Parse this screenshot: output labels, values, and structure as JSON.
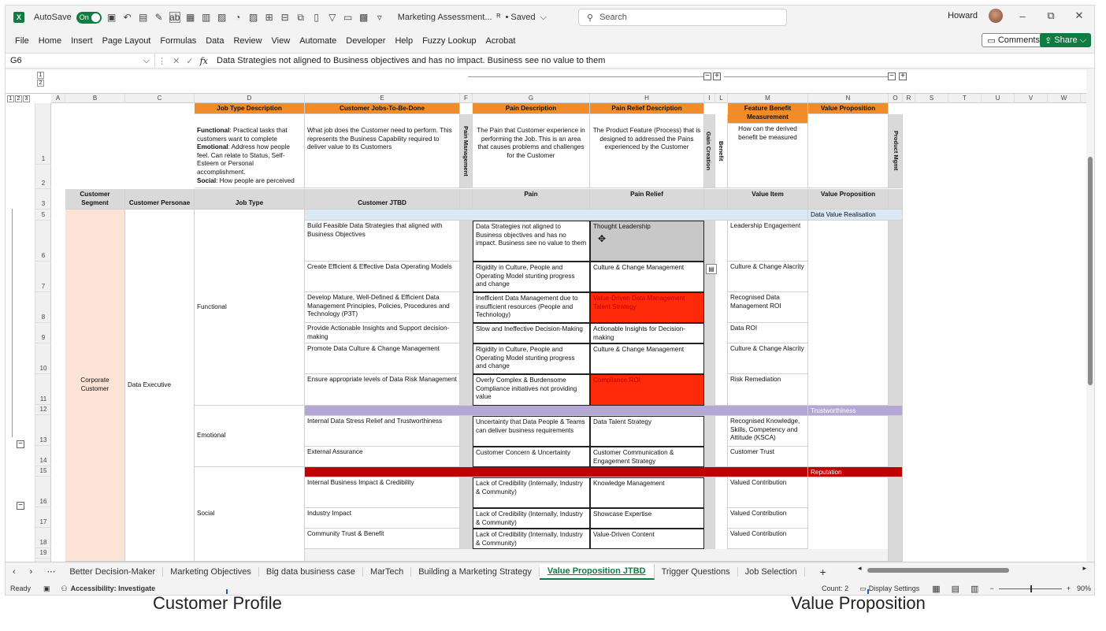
{
  "titlebar": {
    "autosave_label": "AutoSave",
    "autosave_state": "On",
    "doc_title": "Marketing Assessment...",
    "saved_status": "• Saved",
    "search_placeholder": "Search",
    "user_name": "Howard"
  },
  "menu": [
    "File",
    "Home",
    "Insert",
    "Page Layout",
    "Formulas",
    "Data",
    "Review",
    "View",
    "Automate",
    "Developer",
    "Help",
    "Fuzzy Lookup",
    "Acrobat"
  ],
  "ribbon_right": {
    "comments": "Comments",
    "share": "Share"
  },
  "formula_bar": {
    "cell_ref": "G6",
    "fx": "fx",
    "content": "Data Strategies not aligned to Business objectives and has no impact. Business see no value to them"
  },
  "outline_levels": [
    "1",
    "2",
    "3"
  ],
  "outline_rows": [
    "1",
    "2"
  ],
  "columns": [
    "A",
    "B",
    "C",
    "D",
    "E",
    "F",
    "G",
    "H",
    "I",
    "L",
    "M",
    "N",
    "O",
    "R",
    "S",
    "T",
    "U",
    "V",
    "W"
  ],
  "rows": [
    "1",
    "2",
    "3",
    "5",
    "6",
    "7",
    "8",
    "9",
    "10",
    "11",
    "12",
    "13",
    "14",
    "15",
    "16",
    "17",
    "18",
    "19"
  ],
  "header": {
    "job_type_desc": "Job Type Description",
    "jtbd": "Customer Jobs-To-Be-Done",
    "pain_desc": "Pain Description",
    "pain_relief_desc": "Pain Relief Description",
    "feature_benefit": "Feature Benefit Measurement",
    "value_prop": "Value Proposition",
    "pain_mgmt": "Pain Management",
    "gain_creation": "Gain Creation",
    "benefit": "Benefit",
    "product_mgmt": "Product Mgmt"
  },
  "descriptions": {
    "job_type_functional_label": "Functional",
    "job_type_functional": ": Practical tasks that customers want to complete",
    "job_type_emotional_label": "Emotional",
    "job_type_emotional": ": Address how people feel. Can relate to Status, Self-Esteem or Personal accomplishment.",
    "job_type_social_label": "Social",
    "job_type_social": ": How people are perceived",
    "jtbd": "What job does the Customer need to perform. This represents the Business Capability required to deliver value to its Customers",
    "pain": "The Pain that Customer experience in performing the Job. This is an area that causes problems and challenges for the Customer",
    "pain_relief": "The Product Feature (Process) that is designed to addressed the Pains experienced by the Customer",
    "benefit": "How can the derived benefit be measured"
  },
  "subheader": {
    "segment": "Customer Segment",
    "persona": "Customer Personae",
    "job_type": "Job Type",
    "jtbd": "Customer JTBD",
    "pain": "Pain",
    "pain_relief": "Pain Relief",
    "value_item": "Value Item",
    "value_prop": "Value Proposition"
  },
  "segment": "Corporate Customer",
  "persona": "Data Executive",
  "job_types": {
    "functional": "Functional",
    "emotional": "Emotional",
    "social": "Social"
  },
  "value_groups": {
    "data": "Data Value Realisation",
    "trust": "Trustworthiness",
    "reputation": "Reputation"
  },
  "table_rows": [
    {
      "jtbd": "Build Feasible Data Strategies that aligned with Business Objectives",
      "pain": "Data Strategies not aligned to Business objectives and has no impact. Business see no value to them",
      "relief": "Thought Leadership",
      "value": "Leadership Engagement"
    },
    {
      "jtbd": "Create Efficient & Effective Data Operating Models",
      "pain": "Rigidity in Culture, People and Operating Model stunting progress and change",
      "relief": "Culture & Change Management",
      "value": "Culture & Change Alacrity"
    },
    {
      "jtbd": "Develop Mature, Well-Defined & Efficient Data Management Principles, Policies, Procedures and Technology (P3T)",
      "pain": "Inefficient Data Management due to insufficient resources (People and Technology)",
      "relief": "Value-Driven Data Management Talent Strategy",
      "value": "Recognised Data Management ROI"
    },
    {
      "jtbd": "Provide Actionable Insights and Support decision-making",
      "pain": "Slow and Ineffective Decision-Making",
      "relief": "Actionable Insights for Decision-making",
      "value": "Data ROI"
    },
    {
      "jtbd": "Promote Data Culture & Change Management",
      "pain": "Rigidity in Culture, People and Operating Model stunting progress and change",
      "relief": "Culture & Change Management",
      "value": "Culture & Change Alacrity"
    },
    {
      "jtbd": "Ensure appropriate levels of Data Risk Management",
      "pain": "Overly Complex & Burdensome Compliance initiatives not providing value",
      "relief": "Compliance ROI",
      "value": "Risk Remediation"
    },
    {
      "jtbd": "Internal Data Stress Relief and Trustworthiness",
      "pain": "Uncertainty that Data People & Teams can deliver business requirements",
      "relief": "Data Talent Strategy",
      "value": "Recognised Knowledge, Skills, Competency and Attitude (KSCA)"
    },
    {
      "jtbd": "External Assurance",
      "pain": "Customer Concern & Uncertainty",
      "relief": "Customer Communication & Engagement Strategy",
      "value": "Customer Trust"
    },
    {
      "jtbd": "Internal Business Impact & Credibility",
      "pain": "Lack of Credibility (Internally, Industry & Community)",
      "relief": "Knowledge Management",
      "value": "Valued Contribution"
    },
    {
      "jtbd": "Industry Impact",
      "pain": "Lack of Credibility (Internally, Industry & Community)",
      "relief": "Showcase Expertise",
      "value": "Valued Contribution"
    },
    {
      "jtbd": "Community Trust & Benefit",
      "pain": "Lack of Credibility (Internally, Industry & Community)",
      "relief": "Value-Driven Content",
      "value": "Valued Contribution"
    }
  ],
  "sheet_tabs": [
    "Better Decision-Maker",
    "Marketing Objectives",
    "Big data business case",
    "MarTech",
    "Building a Marketing Strategy",
    "Value Proposition JTBD",
    "Trigger Questions",
    "Job Selection"
  ],
  "active_tab": "Value Proposition JTBD",
  "status": {
    "ready": "Ready",
    "accessibility": "Accessibility: Investigate",
    "count": "Count: 2",
    "display_settings": "Display Settings",
    "zoom": "90%"
  },
  "captions": {
    "left": "Customer Profile",
    "right": "Value Proposition"
  },
  "colors": {
    "excel_green": "#107c41",
    "orange_header": "#f28c28",
    "red_highlight": "#ff2a0a",
    "lavender": "#b4a7d6",
    "dark_red": "#c00000"
  }
}
